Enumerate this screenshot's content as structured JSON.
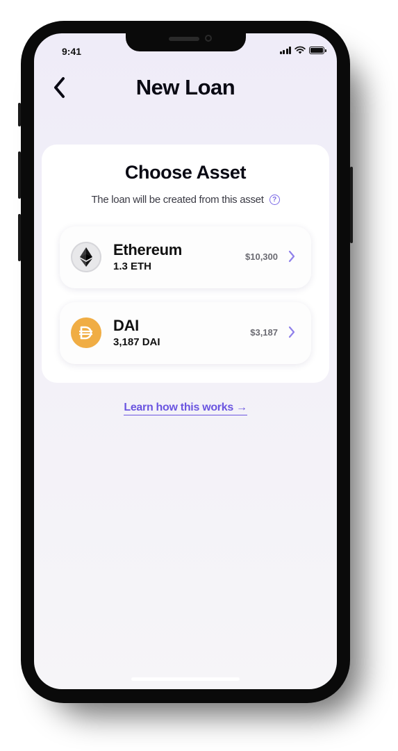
{
  "status_bar": {
    "time": "9:41"
  },
  "header": {
    "title": "New Loan"
  },
  "card": {
    "title": "Choose Asset",
    "subtitle": "The loan will be created from this asset",
    "help_glyph": "?"
  },
  "assets": [
    {
      "name": "Ethereum",
      "amount": "1.3 ETH",
      "value": "$10,300",
      "icon": "ethereum-icon",
      "color": "#e6e6e8"
    },
    {
      "name": "DAI",
      "amount": "3,187 DAI",
      "value": "$3,187",
      "icon": "dai-icon",
      "color": "#f0ad44"
    }
  ],
  "learn_link": {
    "label": "Learn how this works",
    "arrow": "→"
  },
  "colors": {
    "accent": "#6a55e0",
    "dai": "#f0ad44",
    "background": "#f0eef8"
  }
}
